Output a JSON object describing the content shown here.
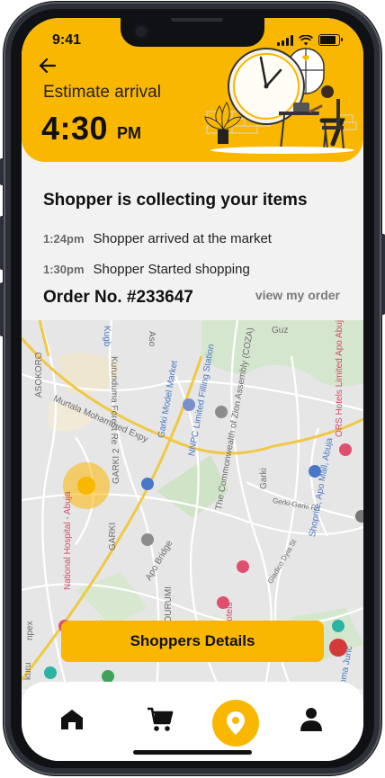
{
  "status_bar": {
    "time": "9:41"
  },
  "header": {
    "eta_label": "Estimate arrival",
    "eta_time": "4:30",
    "eta_ampm": "PM"
  },
  "info": {
    "title": "Shopper is collecting your items",
    "events": [
      {
        "time": "1:24pm",
        "text": "Shopper arrived at the market"
      },
      {
        "time": "1:30pm",
        "text": "Shopper Started shopping"
      }
    ],
    "order_no": "Order No. #233647",
    "view_order": "view my order"
  },
  "map": {
    "labels": [
      "ASOKORO",
      "Kurunduma Forest Re",
      "Aso",
      "Guz",
      "Kugb",
      "Murtala Mohammed Expy",
      "Garki Model Market",
      "NNPC Limited Filling Station",
      "The Commonwealth of Zion Assembly (COZA)",
      "Garki",
      "GARKI 2",
      "National Hospital - Abuja",
      "Gerki-Garki Rd",
      "Shoprite, Apo Mall, Abuja",
      "ORS Hotels Limited Apo Abuja",
      "Apo Bridge",
      "DURUMI",
      "Gladico Dyia St",
      "GARKI",
      "Hotels",
      "npex",
      "nplex",
      "kuru",
      "oma Junc"
    ]
  },
  "actions": {
    "shoppers_details": "Shoppers Details"
  },
  "nav": [
    "home-icon",
    "cart-icon",
    "location-pin-icon",
    "profile-icon"
  ],
  "colors": {
    "brand": "#f9b700",
    "text": "#111111"
  }
}
